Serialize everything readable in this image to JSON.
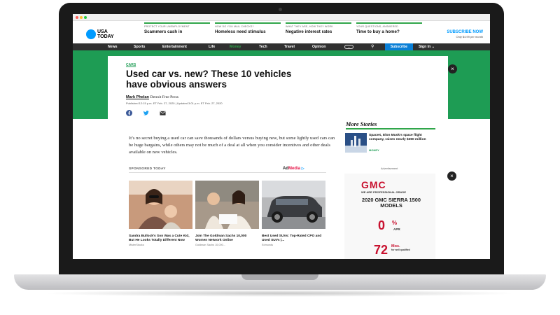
{
  "header": {
    "logo_line1": "USA",
    "logo_line2": "TODAY",
    "promos": [
      {
        "category": "PROTECT YOUR UNEMPLOYMENT",
        "headline": "Scammers cash in"
      },
      {
        "category": "HOW DO YOU MAIL CHECKS?",
        "headline": "Homeless need stimulus"
      },
      {
        "category": "WHAT THEY ARE, HOW THEY WORK",
        "headline": "Negative interest rates"
      },
      {
        "category": "YOUR QUESTIONS, ANSWERED",
        "headline": "Time to buy a home?"
      }
    ],
    "subscribe_title": "SUBSCRIBE NOW",
    "subscribe_sub": "Only $4.99 per month"
  },
  "nav": {
    "items": [
      "News",
      "Sports",
      "Entertainment",
      "Life",
      "Money",
      "Tech",
      "Travel",
      "Opinion"
    ],
    "subscribe": "Subscribe",
    "signin": "Sign In ⌄"
  },
  "article": {
    "kicker": "CARS",
    "headline": "Used car vs. new? These 10 vehicles have obvious answers",
    "author": "Mark Phelan",
    "publication": "Detroit Free Press",
    "dateline": "Published 12:15 p.m. ET Feb. 27, 2020 | Updated 3:01 p.m. ET Feb. 27, 2020",
    "body": "It’s no secret buying a used car can save thousands of dollars versus buying new, but some lightly used cars can be huge bargains, while others may not be much of a deal at all when you consider incentives and other deals available on new vehicles."
  },
  "sponsored": {
    "label": "SPONSORED TODAY",
    "provider_a": "Ad",
    "provider_b": "Media",
    "cards": [
      {
        "title": "Sandra Bullock's Son Was a Cute Kid, But He Looks Totally Different Now",
        "source": "MisterStocks"
      },
      {
        "title": "Join The Goldman Sachs 10,000 Women Network Online",
        "source": "Goldman Sachs 10,000..."
      },
      {
        "title": "Best Used SUVs: Top-Rated CPO and Used SUVs |...",
        "source": "Edmunds"
      }
    ]
  },
  "sidebar": {
    "more_stories": "More Stories",
    "story_title": "SpaceX, Elon Musk's space flight company, raises nearly $350 million",
    "story_category": "MONEY",
    "ad_label": "Advertisement",
    "ad": {
      "brand": "GMC",
      "tagline": "WE ARE PROFESSIONAL GRADE",
      "model": "2020 GMC SIERRA 1500 MODELS",
      "rate": "0",
      "rate_unit": "%",
      "rate_label": "APR",
      "term": "72",
      "term_unit": "Mos.",
      "term_sub": "for well qualified"
    }
  },
  "colors": {
    "accent_green": "#1e9c54",
    "brand_blue": "#009bff",
    "gmc_red": "#c8102e"
  }
}
